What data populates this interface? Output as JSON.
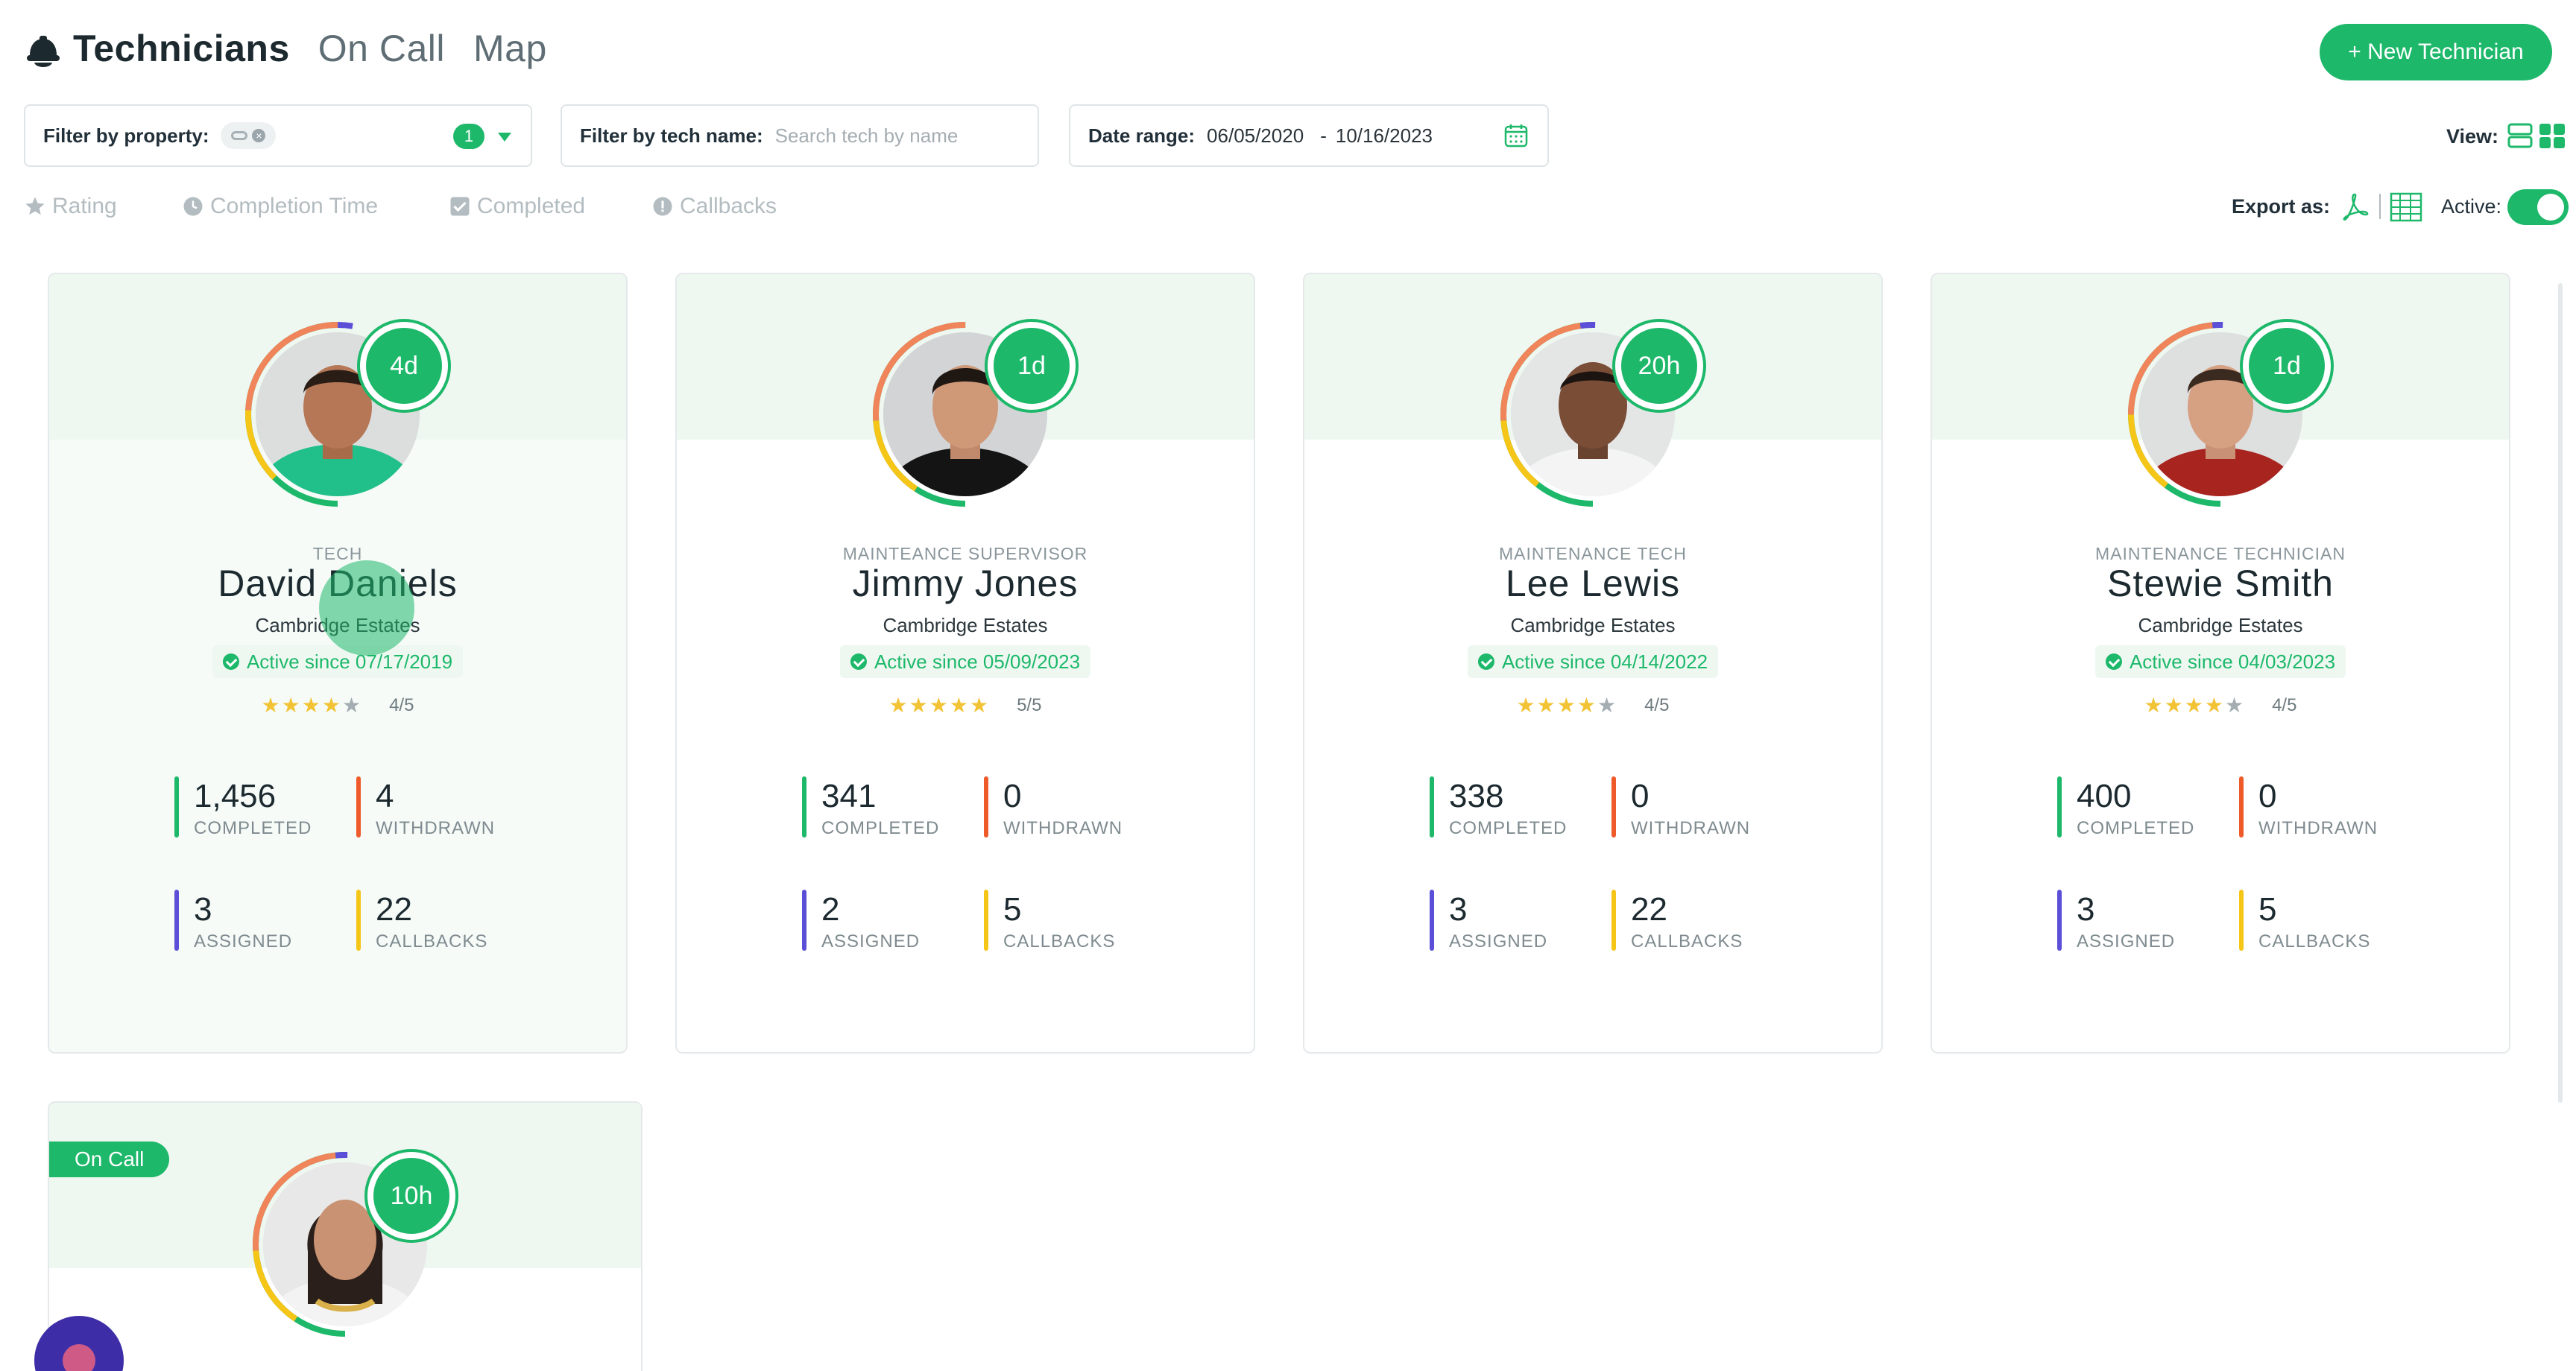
{
  "header": {
    "title": "Technicians",
    "tabs": [
      "On Call",
      "Map"
    ],
    "new_button": "+ New Technician"
  },
  "filters": {
    "property_label": "Filter by property:",
    "property_count": "1",
    "tech_label": "Filter by tech name:",
    "tech_placeholder": "Search tech by name",
    "date_label": "Date range:",
    "date_from": "06/05/2020",
    "date_separator": "-",
    "date_to": "10/16/2023",
    "view_label": "View:"
  },
  "sort": {
    "items": [
      "Rating",
      "Completion Time",
      "Completed",
      "Callbacks"
    ],
    "export_label": "Export as:",
    "active_label": "Active:",
    "active_on": true
  },
  "colors": {
    "accent": "#1db86a",
    "completed": "#1db86a",
    "withdrawn": "#ef5a2a",
    "assigned": "#5a4fd6",
    "callbacks": "#f5c518",
    "star": "#f2c335"
  },
  "technicians": [
    {
      "badge": "4d",
      "role": "TECH",
      "name": "David Daniels",
      "property": "Cambridge Estates",
      "active_since": "Active since 07/17/2019",
      "rating": 4,
      "rating_text": "4/5",
      "stats": {
        "completed": "1,456",
        "completed_label": "COMPLETED",
        "withdrawn": "4",
        "withdrawn_label": "WITHDRAWN",
        "assigned": "3",
        "assigned_label": "ASSIGNED",
        "callbacks": "22",
        "callbacks_label": "CALLBACKS"
      }
    },
    {
      "badge": "1d",
      "role": "MAINTEANCE SUPERVISOR",
      "name": "Jimmy Jones",
      "property": "Cambridge Estates",
      "active_since": "Active since 05/09/2023",
      "rating": 5,
      "rating_text": "5/5",
      "stats": {
        "completed": "341",
        "completed_label": "COMPLETED",
        "withdrawn": "0",
        "withdrawn_label": "WITHDRAWN",
        "assigned": "2",
        "assigned_label": "ASSIGNED",
        "callbacks": "5",
        "callbacks_label": "CALLBACKS"
      }
    },
    {
      "badge": "20h",
      "role": "MAINTENANCE TECH",
      "name": "Lee Lewis",
      "property": "Cambridge Estates",
      "active_since": "Active since 04/14/2022",
      "rating": 4,
      "rating_text": "4/5",
      "stats": {
        "completed": "338",
        "completed_label": "COMPLETED",
        "withdrawn": "0",
        "withdrawn_label": "WITHDRAWN",
        "assigned": "3",
        "assigned_label": "ASSIGNED",
        "callbacks": "22",
        "callbacks_label": "CALLBACKS"
      }
    },
    {
      "badge": "1d",
      "role": "MAINTENANCE TECHNICIAN",
      "name": "Stewie Smith",
      "property": "Cambridge Estates",
      "active_since": "Active since 04/03/2023",
      "rating": 4,
      "rating_text": "4/5",
      "stats": {
        "completed": "400",
        "completed_label": "COMPLETED",
        "withdrawn": "0",
        "withdrawn_label": "WITHDRAWN",
        "assigned": "3",
        "assigned_label": "ASSIGNED",
        "callbacks": "5",
        "callbacks_label": "CALLBACKS"
      }
    },
    {
      "badge": "10h",
      "on_call_label": "On Call"
    }
  ]
}
